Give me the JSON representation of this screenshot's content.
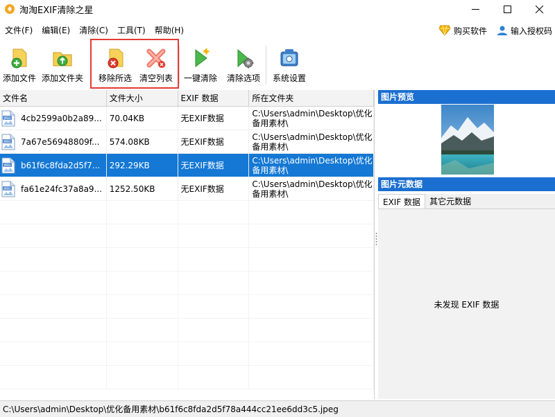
{
  "window": {
    "title": "淘淘EXIF清除之星"
  },
  "menu": {
    "items": [
      "文件(F)",
      "编辑(E)",
      "清除(C)",
      "工具(T)",
      "帮助(H)"
    ],
    "buy_label": "购买软件",
    "license_label": "输入授权码"
  },
  "toolbar": {
    "add_file": "添加文件",
    "add_folder": "添加文件夹",
    "remove_selected": "移除所选",
    "clear_list": "清空列表",
    "one_click_clean": "一键清除",
    "clean_options": "清除选项",
    "system_settings": "系统设置"
  },
  "file_list": {
    "columns": [
      "文件名",
      "文件大小",
      "EXIF 数据",
      "所在文件夹"
    ],
    "rows": [
      {
        "name": "4cb2599a0b2a89...",
        "size": "70.04KB",
        "exif": "无EXIF数据",
        "dir1": "C:\\Users\\admin\\Desktop\\优化",
        "dir2": "备用素材\\"
      },
      {
        "name": "7a67e56948809f...",
        "size": "574.08KB",
        "exif": "无EXIF数据",
        "dir1": "C:\\Users\\admin\\Desktop\\优化",
        "dir2": "备用素材\\"
      },
      {
        "name": "b61f6c8fda2d5f7...",
        "size": "292.29KB",
        "exif": "无EXIF数据",
        "dir1": "C:\\Users\\admin\\Desktop\\优化",
        "dir2": "备用素材\\"
      },
      {
        "name": "fa61e24fc37a8a9...",
        "size": "1252.50KB",
        "exif": "无EXIF数据",
        "dir1": "C:\\Users\\admin\\Desktop\\优化",
        "dir2": "备用素材\\"
      }
    ],
    "selected_index": 2,
    "icon_text": "JPEG"
  },
  "preview": {
    "header": "图片预览"
  },
  "metadata": {
    "header": "图片元数据",
    "tabs": [
      "EXIF 数据",
      "其它元数据"
    ],
    "empty_message": "未发现 EXIF 数据"
  },
  "status": {
    "path": "C:\\Users\\admin\\Desktop\\优化备用素材\\b61f6c8fda2d5f78a444cc21ee6dd3c5.jpeg"
  },
  "colors": {
    "accent": "#1b6fd0",
    "selection": "#1478d4",
    "highlight_border": "#e53935"
  }
}
